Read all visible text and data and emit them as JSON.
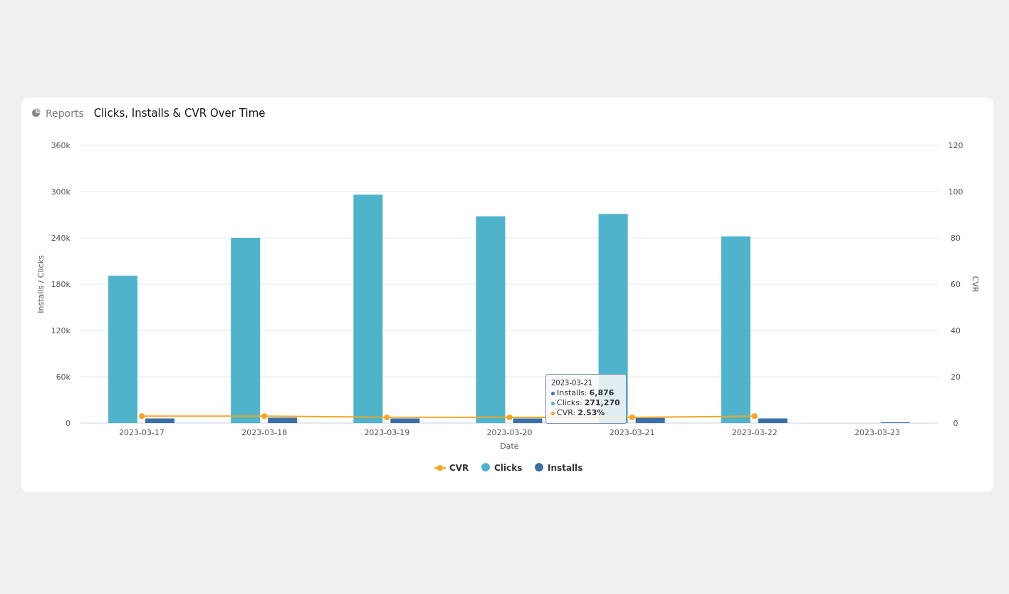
{
  "header": {
    "breadcrumb": "Reports",
    "title": "Clicks, Installs & CVR Over Time"
  },
  "chart": {
    "chart_data": {
      "type": "bar",
      "xlabel": "Date",
      "ylabel": "Installs / Clicks",
      "y2label": "CVR",
      "grid": true,
      "legend": true,
      "categories": [
        "2023-03-17",
        "2023-03-18",
        "2023-03-19",
        "2023-03-20",
        "2023-03-21",
        "2023-03-22",
        "2023-03-23"
      ],
      "series": [
        {
          "name": "CVR",
          "color": "#f5a623",
          "type": "line",
          "axis": "y2",
          "marker": "circle",
          "values": [
            3,
            3,
            2.5,
            2.5,
            2.5,
            3,
            null
          ]
        },
        {
          "name": "Clicks",
          "color": "#4fb3cc",
          "values": [
            191000,
            240000,
            296000,
            268000,
            271000,
            242000,
            0
          ]
        },
        {
          "name": "Installs",
          "color": "#3a6fa8",
          "values": [
            6000,
            7000,
            6000,
            6000,
            7000,
            6000,
            1000
          ]
        }
      ],
      "ylim": [
        0,
        360000
      ],
      "yticks": [
        {
          "value": 0,
          "label": "0"
        },
        {
          "value": 60000,
          "label": "60k"
        },
        {
          "value": 120000,
          "label": "120k"
        },
        {
          "value": 180000,
          "label": "180k"
        },
        {
          "value": 240000,
          "label": "240k"
        },
        {
          "value": 300000,
          "label": "300k"
        },
        {
          "value": 360000,
          "label": "360k"
        }
      ],
      "y2lim": [
        0,
        120
      ],
      "y2ticks": [
        {
          "value": 0,
          "label": "0"
        },
        {
          "value": 20,
          "label": "20"
        },
        {
          "value": 40,
          "label": "40"
        },
        {
          "value": 60,
          "label": "60"
        },
        {
          "value": 80,
          "label": "80"
        },
        {
          "value": 100,
          "label": "100"
        },
        {
          "value": 120,
          "label": "120"
        }
      ]
    },
    "tooltip": {
      "title": "2023-03-21",
      "items": [
        {
          "label": "Installs:",
          "value": "6,876",
          "color": "#3a6fa8"
        },
        {
          "label": "Clicks:",
          "value": "271,270",
          "color": "#4fb3cc"
        },
        {
          "label": "CVR:",
          "value": "2.53%",
          "color": "#f5a623"
        }
      ]
    }
  }
}
